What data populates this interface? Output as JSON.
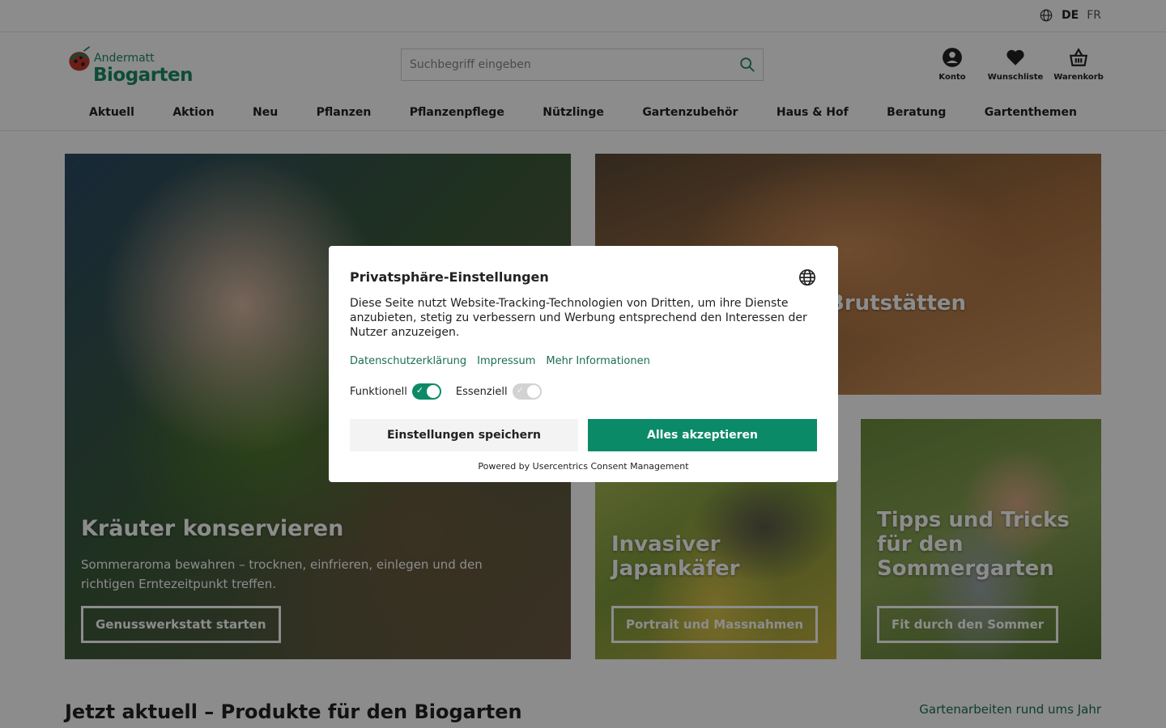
{
  "topbar": {
    "lang_de": "DE",
    "lang_fr": "FR",
    "globe_icon": "globe-icon"
  },
  "header": {
    "logo_small": "Andermatt",
    "logo_big": "Biogarten",
    "search_placeholder": "Suchbegriff eingeben",
    "actions": [
      {
        "label": "Konto",
        "icon": "user-icon"
      },
      {
        "label": "Wunschliste",
        "icon": "heart-icon"
      },
      {
        "label": "Warenkorb",
        "icon": "basket-icon"
      }
    ]
  },
  "nav": {
    "items": [
      "Aktuell",
      "Aktion",
      "Neu",
      "Pflanzen",
      "Pflanzenpflege",
      "Nützlinge",
      "Gartenzubehör",
      "Haus & Hof",
      "Beratung",
      "Gartenthemen"
    ]
  },
  "hero": {
    "big": {
      "title": "Kräuter konservieren",
      "text": "Sommeraroma bewahren – trocknen, einfrieren, einlegen und den richtigen Erntezeitpunkt treffen.",
      "button": "Genusswerkstatt starten"
    },
    "top": {
      "title": "Brutstätten"
    },
    "mid": {
      "title": "Invasiver Japankäfer",
      "button": "Portrait und Massnahmen"
    },
    "right": {
      "title": "Tipps und Tricks für den Sommergarten",
      "button": "Fit durch den Sommer"
    }
  },
  "section": {
    "title": "Jetzt aktuell – Produkte für den Biogarten",
    "link": "Gartenarbeiten rund ums Jahr"
  },
  "consent": {
    "title": "Privatsphäre-Einstellungen",
    "text": "Diese Seite nutzt Website-Tracking-Technologien von Dritten, um ihre Dienste anzubieten, stetig zu verbessern und Werbung entsprechend den Interessen der Nutzer anzuzeigen.",
    "links": [
      "Datenschutzerklärung",
      "Impressum",
      "Mehr Informationen"
    ],
    "toggles": [
      {
        "label": "Funktionell",
        "on": true
      },
      {
        "label": "Essenziell",
        "on": true,
        "disabled": true
      }
    ],
    "save_button": "Einstellungen speichern",
    "accept_button": "Alles akzeptieren",
    "powered": "Powered by Usercentrics Consent Management",
    "accent": "#0b8a67"
  }
}
